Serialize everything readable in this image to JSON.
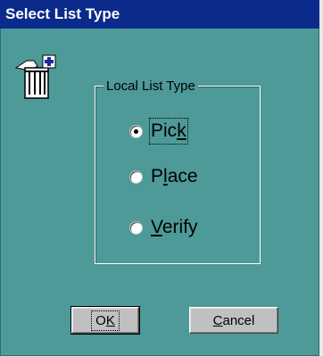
{
  "window": {
    "title": "Select List Type"
  },
  "group": {
    "label": "Local List Type"
  },
  "options": [
    {
      "pre": "Pic",
      "key": "k",
      "post": "",
      "checked": true
    },
    {
      "pre": "P",
      "key": "l",
      "post": "ace",
      "checked": false
    },
    {
      "pre": "",
      "key": "V",
      "post": "erify",
      "checked": false
    }
  ],
  "buttons": {
    "ok": {
      "pre": "O",
      "key": "K",
      "post": ""
    },
    "cancel": {
      "pre": "",
      "key": "C",
      "post": "ancel"
    }
  },
  "icons": {
    "app": "list-add-icon"
  },
  "colors": {
    "window_bg": "#4d9a98",
    "titlebar_bg": "#0a2a8c",
    "button_face": "#c0c0c0"
  }
}
